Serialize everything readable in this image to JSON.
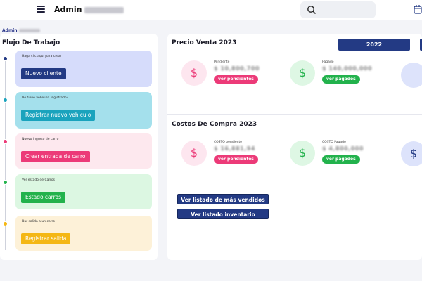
{
  "header": {
    "title": "Admin",
    "breadcrumb": "Admin"
  },
  "workflow": {
    "title": "Flujo De Trabajo",
    "steps": [
      {
        "note": "Haga clic aquí para crear",
        "button": "Nuevo cliente",
        "bg": "#d6dcfb",
        "btn": "#233a84",
        "dot": "#233a84"
      },
      {
        "note": "No tiene vehículo registrado?",
        "button": "Registrar nuevo vehiculo",
        "bg": "#a4e0ec",
        "btn": "#1aa3bd",
        "dot": "#1aa3bd"
      },
      {
        "note": "Nuevo ingreso de carro",
        "button": "Crear entrada de carro",
        "bg": "#fde8ee",
        "btn": "#ec3a78",
        "dot": "#ec3a78"
      },
      {
        "note": "Ver estado de Carros",
        "button": "Estado carros",
        "bg": "#dcf7e2",
        "btn": "#22b24c",
        "dot": "#22b24c"
      },
      {
        "note": "Dar salida a un carro",
        "button": "Registrar salida",
        "bg": "#fdf1d8",
        "btn": "#f4b715",
        "dot": "#f4b715"
      }
    ]
  },
  "sales": {
    "title": "Precio Venta 2023",
    "year_button": "2022",
    "pending_label": "Pendiente",
    "pending_value": "$ 10,800,700",
    "pending_button": "ver pendientes",
    "paid_label": "Pagado",
    "paid_value": "$ 140,000,000",
    "paid_button": "ver pagados"
  },
  "costs": {
    "title": "Costos De Compra 2023",
    "pending_label": "COSTO pendiente",
    "pending_value": "$ 16,881,94",
    "pending_button": "ver pendientes",
    "paid_label": "COSTO Pagado",
    "paid_value": "$ 4,800,000",
    "paid_button": "ver pagados"
  },
  "links": {
    "best_sellers": "Ver listado de más vendidos",
    "inventory": "Ver listado inventario"
  },
  "colors": {
    "primary": "#233a84",
    "pink": "#ec3a78",
    "green": "#22b24c"
  }
}
